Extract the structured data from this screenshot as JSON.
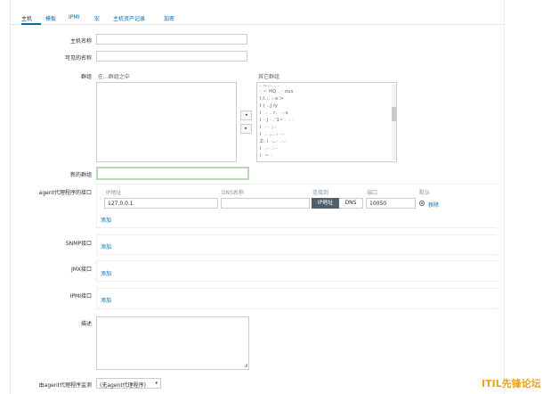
{
  "tabs": [
    {
      "label": "主机",
      "active": true
    },
    {
      "label": "模板"
    },
    {
      "label": "IPMI"
    },
    {
      "label": "宏"
    },
    {
      "label": "主机资产记录"
    },
    {
      "label": "加密"
    }
  ],
  "form": {
    "host_name_label": "主机名称",
    "visible_name_label": "可见的名称",
    "groups_label": "群组",
    "in_groups_label": "在...群组之中",
    "other_groups_label": "其它群组",
    "other_groups": [
      "· ~·:· · ·",
      "· ~ HQ  . · ous",
      "I;I.:, :-x:>",
      "I·( ..J·ly",
      "I· .· .  r, · .-s",
      "I·· J · .'1~ · · ·",
      "I·  ·  · ;.·",
      "I· . .,.·.:  ···",
      "Z:  i. :,.· .·.·",
      "I· .·· .···",
      "l·  ~ ·"
    ],
    "move_left_symbol": "◂",
    "move_right_symbol": "▸",
    "new_group_label": "新的群组",
    "agent_label": "agent代理程序的接口",
    "col_ip": "IP地址",
    "col_dns": "DNS名称",
    "col_connect": "连接到",
    "col_port": "端口",
    "col_default": "默认",
    "agent_ip": "127.0.0.1",
    "agent_dns": "",
    "connect_ip": "IP地址",
    "connect_dns": "DNS",
    "agent_port": "10050",
    "remove_label": "移除",
    "add_label": "添加",
    "snmp_label": "SNMP接口",
    "jmx_label": "JMX接口",
    "ipmi_label": "IPMI接口",
    "description_label": "描述",
    "proxy_label": "由agent代理程序监测",
    "proxy_value": "(无agent代理程序)",
    "caret": "▾"
  },
  "watermark": "ITIL先锋论坛",
  "colors": {
    "link": "#0a6aa8",
    "active_segment": "#4f5f6b",
    "focus_border": "#b6dab7",
    "watermark": "#e8a21d"
  }
}
